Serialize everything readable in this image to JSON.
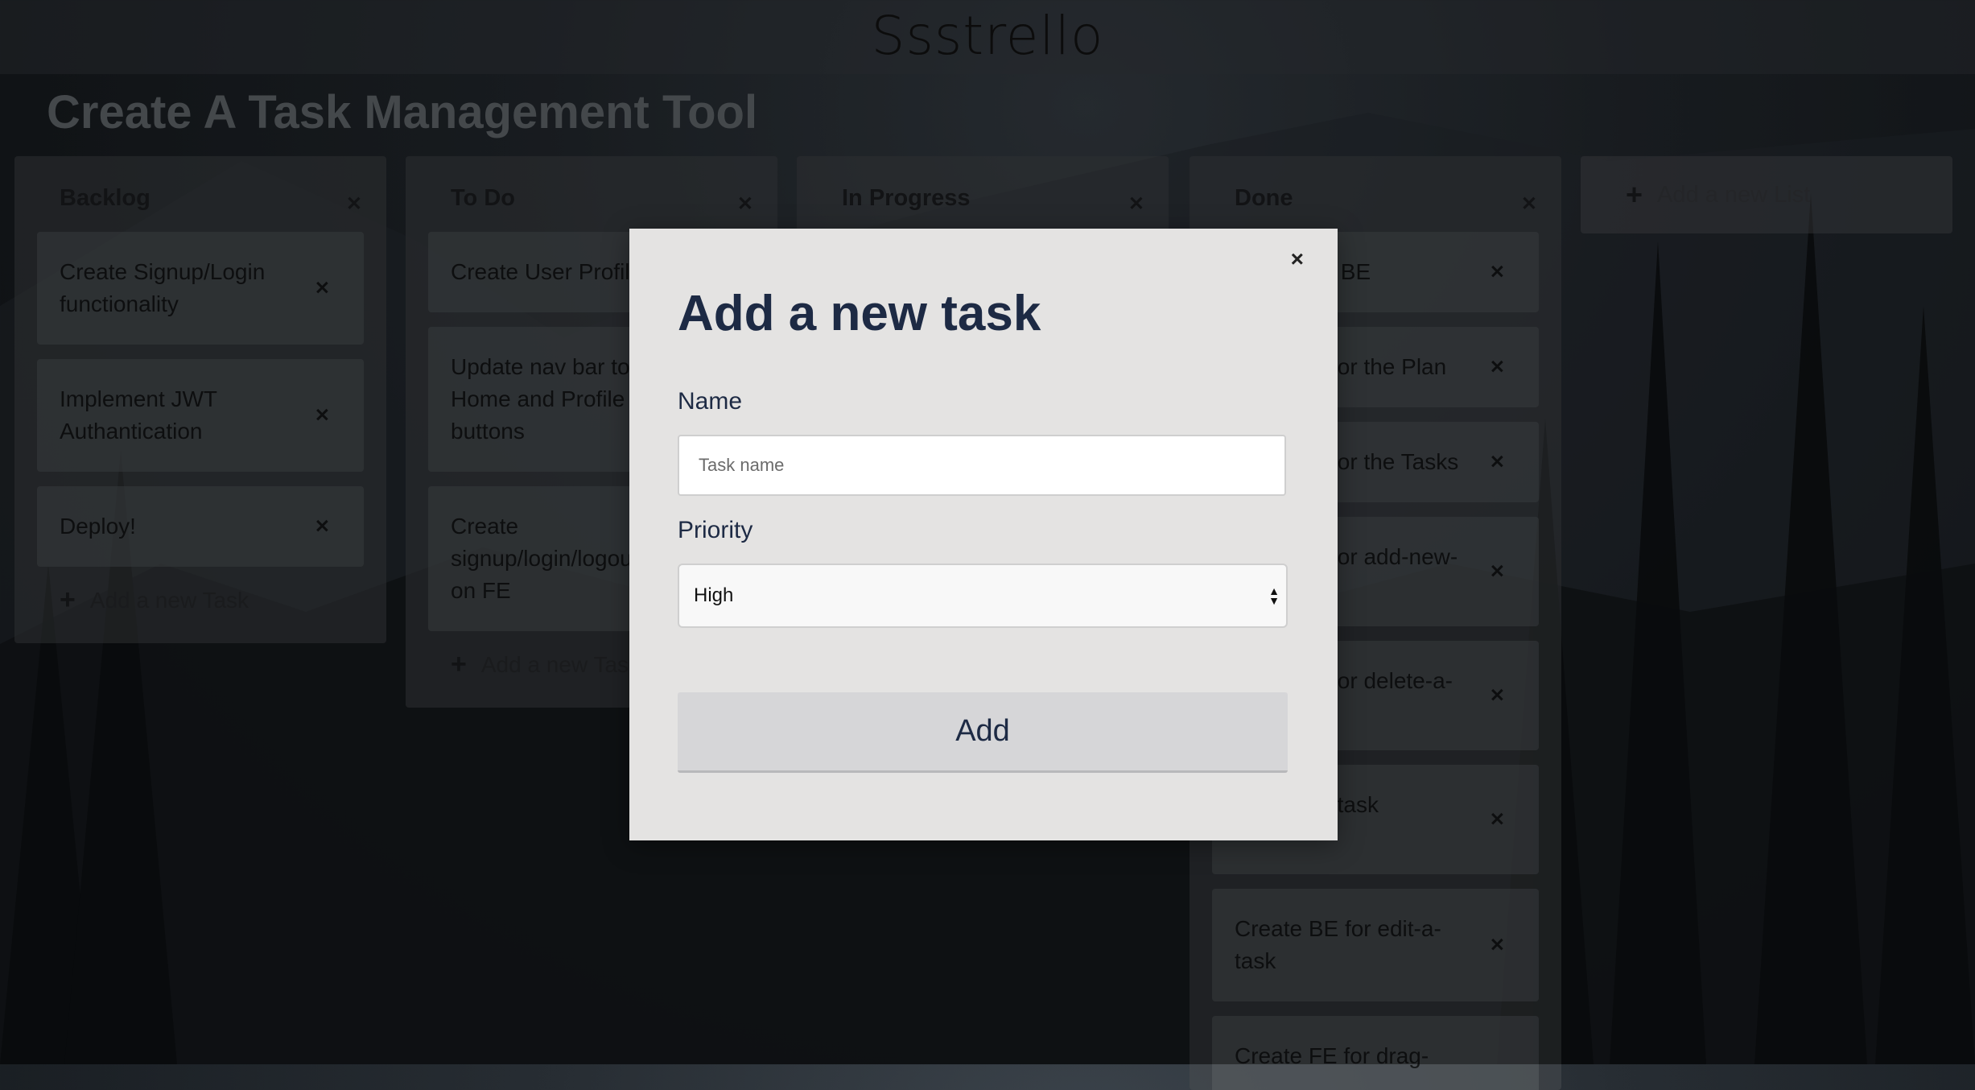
{
  "header": {
    "logo": "Ssstrello"
  },
  "board": {
    "title": "Create A Task Management Tool"
  },
  "lists": [
    {
      "title": "Backlog",
      "cards": [
        "Create Signup/Login functionality",
        "Implement JWT Authantication",
        "Deploy!"
      ],
      "add_task_label": "Add a new Task"
    },
    {
      "title": "To Do",
      "cards": [
        "Create User Profile",
        "Update nav bar to Home and Profile buttons",
        "Create signup/login/logout form on FE"
      ],
      "add_task_label": "Add a new Task"
    },
    {
      "title": "In Progress",
      "cards": [],
      "add_task_label": ""
    },
    {
      "title": "Done",
      "cards": [
        "s BE",
        "for the Plan",
        "for the Tasks",
        "for add-new-",
        "for delete-a-",
        "for edit-a- task",
        "Create BE for edit-a-task",
        "Create FE for drag-"
      ],
      "add_task_label": ""
    }
  ],
  "add_list_label": "Add a new List",
  "modal": {
    "title": "Add a new task",
    "name_label": "Name",
    "name_placeholder": "Task name",
    "name_value": "",
    "priority_label": "Priority",
    "priority_selected": "High",
    "submit_label": "Add",
    "close_glyph": "×"
  },
  "icons": {
    "close": "close-icon",
    "plus": "plus-icon",
    "select_arrows": "select-arrows-icon"
  },
  "colors": {
    "title_text": "#1d2a44",
    "modal_bg": "#e4e3e2"
  }
}
